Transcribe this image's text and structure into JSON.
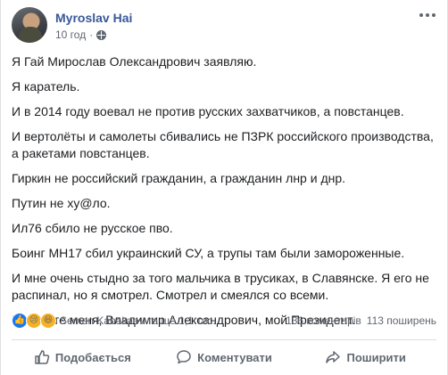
{
  "post": {
    "author": "Myroslav Hai",
    "time": "10 год",
    "paragraphs": [
      "Я Гай Мирослав Олександрович заявляю.",
      "Я каратель.",
      "И в 2014 году воевал не против русских захватчиков, а повстанцев.",
      "И вертолёты и самолеты сбивались не ПЗРК российского производства, а ракетами повстанцев.",
      "Гиркин не российский гражданин, а гражданин лнр и днр.",
      "Путин не ху@ло.",
      "Ил76 сбило не русское пво.",
      "Боинг МН17 сбил украинский СУ, а трупы там были замороженные.",
      "И мне очень стыдно за того мальчика в трусиках, в Славянске. Я его не распинал, но я смотрел. Смотрел и смеялся со всеми.",
      "Простите меня, Владимир Александрович, мой Президент."
    ]
  },
  "stats": {
    "reactors": "Semen Kabakaev та ще 1,1 тис.",
    "comments": "136 коментарів",
    "shares": "113 поширень",
    "reaction_icons": [
      "like-icon",
      "sad-icon",
      "haha-icon"
    ]
  },
  "actions": {
    "like": "Подобається",
    "comment": "Коментувати",
    "share": "Поширити"
  },
  "colors": {
    "author": "#385898",
    "muted": "#606770",
    "like_blue": "#1877f2"
  }
}
